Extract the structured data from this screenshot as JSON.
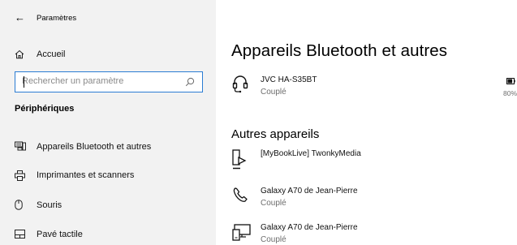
{
  "window": {
    "title": "Paramètres"
  },
  "sidebar": {
    "home_label": "Accueil",
    "search_placeholder": "Rechercher un paramètre",
    "section_heading": "Périphériques",
    "items": [
      {
        "label": "Appareils Bluetooth et autres",
        "icon": "bluetooth-devices-icon"
      },
      {
        "label": "Imprimantes et scanners",
        "icon": "printer-icon"
      },
      {
        "label": "Souris",
        "icon": "mouse-icon"
      },
      {
        "label": "Pavé tactile",
        "icon": "touchpad-icon"
      }
    ]
  },
  "main": {
    "title": "Appareils Bluetooth et autres",
    "audio_device": {
      "name": "JVC HA-S35BT",
      "status": "Couplé",
      "icon": "headset-icon",
      "battery": "80%",
      "battery_level": 0.8
    },
    "other_heading": "Autres appareils",
    "other_devices": [
      {
        "name": "[MyBookLive] TwonkyMedia",
        "status": "",
        "icon": "media-device-icon"
      },
      {
        "name": "Galaxy A70 de Jean-Pierre",
        "status": "Couplé",
        "icon": "phone-icon"
      },
      {
        "name": "Galaxy A70 de Jean-Pierre",
        "status": "Couplé",
        "icon": "computer-phone-icon"
      }
    ]
  }
}
